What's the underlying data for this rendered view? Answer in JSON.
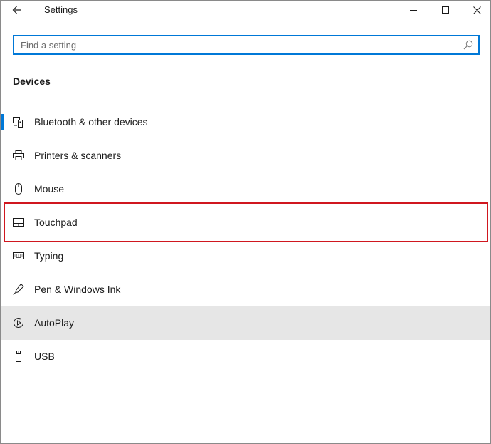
{
  "window": {
    "title": "Settings",
    "back_icon": "back-arrow-icon",
    "controls": [
      "minimize-icon",
      "maximize-icon",
      "close-icon"
    ]
  },
  "search": {
    "placeholder": "Find a setting",
    "value": "",
    "icon": "search-icon"
  },
  "section": {
    "title": "Devices"
  },
  "nav": {
    "items": [
      {
        "label": "Bluetooth & other devices",
        "icon": "bluetooth-devices-icon",
        "selected": true
      },
      {
        "label": "Printers & scanners",
        "icon": "printer-icon"
      },
      {
        "label": "Mouse",
        "icon": "mouse-icon"
      },
      {
        "label": "Touchpad",
        "icon": "touchpad-icon",
        "highlighted": true
      },
      {
        "label": "Typing",
        "icon": "keyboard-icon"
      },
      {
        "label": "Pen & Windows Ink",
        "icon": "pen-icon"
      },
      {
        "label": "AutoPlay",
        "icon": "autoplay-icon",
        "hover": true
      },
      {
        "label": "USB",
        "icon": "usb-icon"
      }
    ]
  },
  "colors": {
    "accent": "#0078d7",
    "highlight_border": "#d0171f",
    "hover_bg": "#e6e6e6"
  }
}
